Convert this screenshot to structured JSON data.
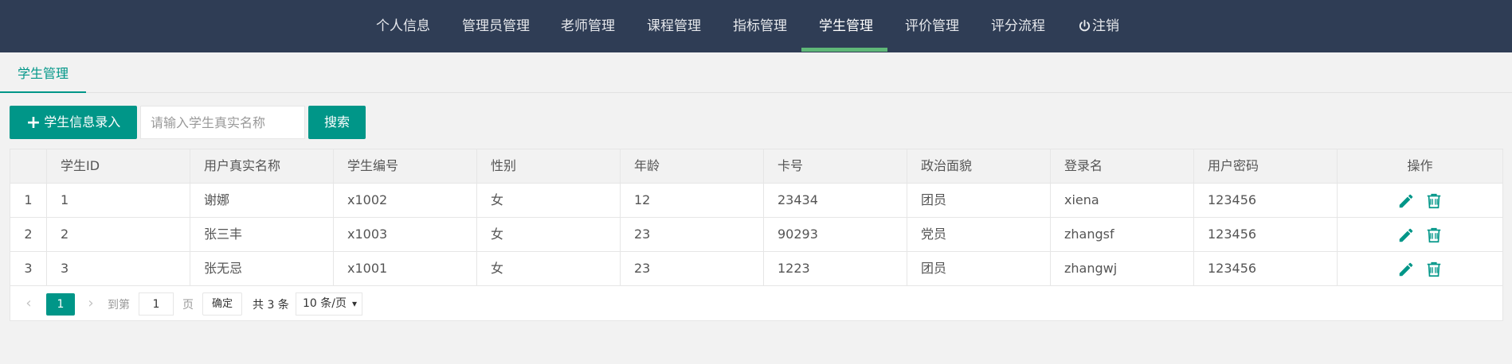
{
  "nav": {
    "items": [
      "个人信息",
      "管理员管理",
      "老师管理",
      "课程管理",
      "指标管理",
      "学生管理",
      "评价管理",
      "评分流程"
    ],
    "logout": "注销",
    "active_index": 5
  },
  "tab": {
    "label": "学生管理"
  },
  "toolbar": {
    "add_label": "学生信息录入",
    "search_placeholder": "请输入学生真实名称",
    "search_label": "搜索"
  },
  "table": {
    "headers": [
      "",
      "学生ID",
      "用户真实名称",
      "学生编号",
      "性别",
      "年龄",
      "卡号",
      "政治面貌",
      "登录名",
      "用户密码",
      "操作"
    ],
    "rows": [
      [
        "1",
        "1",
        "谢娜",
        "x1002",
        "女",
        "12",
        "23434",
        "团员",
        "xiena",
        "123456"
      ],
      [
        "2",
        "2",
        "张三丰",
        "x1003",
        "女",
        "23",
        "90293",
        "党员",
        "zhangsf",
        "123456"
      ],
      [
        "3",
        "3",
        "张无忌",
        "x1001",
        "女",
        "23",
        "1223",
        "团员",
        "zhangwj",
        "123456"
      ]
    ]
  },
  "pager": {
    "prev": "‹",
    "next": "›",
    "current": "1",
    "goto_label": "到第",
    "goto_value": "1",
    "page_unit": "页",
    "confirm": "确定",
    "total": "共 3 条",
    "page_size": "10 条/页"
  },
  "colors": {
    "nav_bg": "#2f3d55",
    "accent": "#009688",
    "nav_indicator": "#5fb878"
  },
  "icons": {
    "edit": "pencil-icon",
    "delete": "trash-icon",
    "logout": "power-icon",
    "add": "plus-icon"
  }
}
